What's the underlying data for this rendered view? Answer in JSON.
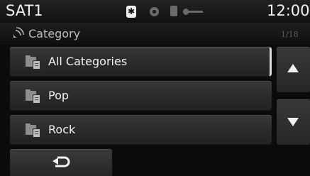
{
  "status_bar": {
    "source": "SAT1",
    "clock": "12:00",
    "icons": [
      "bluetooth-icon",
      "disc-icon",
      "sd-card-icon",
      "usb-icon"
    ]
  },
  "header": {
    "title": "Category",
    "page_indicator": "1/18",
    "icon": "satellite-icon"
  },
  "categories": [
    {
      "label": "All Categories",
      "icon": "folder-icon",
      "selected": true
    },
    {
      "label": "Pop",
      "icon": "folder-icon",
      "selected": false
    },
    {
      "label": "Rock",
      "icon": "folder-icon",
      "selected": false
    }
  ],
  "scroll": {
    "up_icon": "arrow-up-icon",
    "down_icon": "arrow-down-icon"
  },
  "footer": {
    "back_icon": "back-arrow-icon"
  },
  "colors": {
    "background": "#0b0b0b",
    "button": "#2e2e2e",
    "text": "#f2f2f2",
    "muted": "#5a5a5a"
  }
}
